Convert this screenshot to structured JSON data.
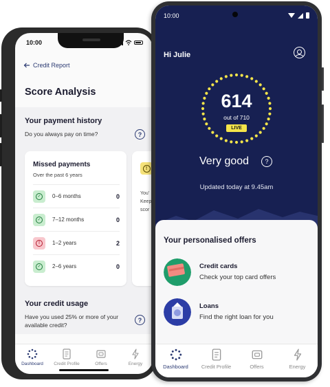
{
  "phone_left": {
    "status_time": "10:00",
    "back_label": "Credit Report",
    "title": "Score Analysis",
    "payment_history": {
      "title": "Your payment history",
      "subtitle": "Do you always pay on time?",
      "help_glyph": "?"
    },
    "missed_payments": {
      "title": "Missed payments",
      "subtitle": "Over the past 6 years",
      "rows": [
        {
          "label": "0–6 months",
          "count": "0",
          "status": "ok"
        },
        {
          "label": "7–12 months",
          "count": "0",
          "status": "ok"
        },
        {
          "label": "1–2 years",
          "count": "2",
          "status": "bad"
        },
        {
          "label": "2–6 years",
          "count": "0",
          "status": "ok"
        }
      ]
    },
    "peek_card": {
      "icon_glyph": "!",
      "line1": "You'",
      "line2": "Keep",
      "line3": "scor"
    },
    "credit_usage": {
      "title": "Your credit usage",
      "subtitle_line1": "Have you used 25% or more of your",
      "subtitle_line2": "available credit?",
      "help_glyph": "?"
    },
    "nav": [
      {
        "label": "Dashboard",
        "icon": "dashboard-dots-icon",
        "active": true
      },
      {
        "label": "Credit Profile",
        "icon": "credit-profile-icon",
        "active": false
      },
      {
        "label": "Offers",
        "icon": "offers-wallet-icon",
        "active": false
      },
      {
        "label": "Energy",
        "icon": "energy-bolt-icon",
        "active": false
      }
    ]
  },
  "phone_right": {
    "status_time": "10:00",
    "greeting": "Hi Julie",
    "score": "614",
    "score_out_of": "out of 710",
    "live_badge": "LIVE",
    "rating": "Very good",
    "rating_help_glyph": "?",
    "updated": "Updated today at 9.45am",
    "offers_title": "Your personalised offers",
    "offers": [
      {
        "title": "Credit cards",
        "subtitle": "Check your top card offers",
        "icon": "credit-card-icon"
      },
      {
        "title": "Loans",
        "subtitle": "Find the right loan for you",
        "icon": "loans-icon"
      }
    ],
    "nav": [
      {
        "label": "Dashboard",
        "icon": "dashboard-dots-icon",
        "active": true
      },
      {
        "label": "Credit Profile",
        "icon": "credit-profile-icon",
        "active": false
      },
      {
        "label": "Offers",
        "icon": "offers-wallet-icon",
        "active": false
      },
      {
        "label": "Energy",
        "icon": "energy-bolt-icon",
        "active": false
      }
    ]
  },
  "colors": {
    "navy": "#172052",
    "gauge_yellow": "#f4e44a",
    "ok_green_bg": "#c9edcf",
    "bad_red_bg": "#f8c7cd",
    "nav_active": "#2b3a72"
  }
}
